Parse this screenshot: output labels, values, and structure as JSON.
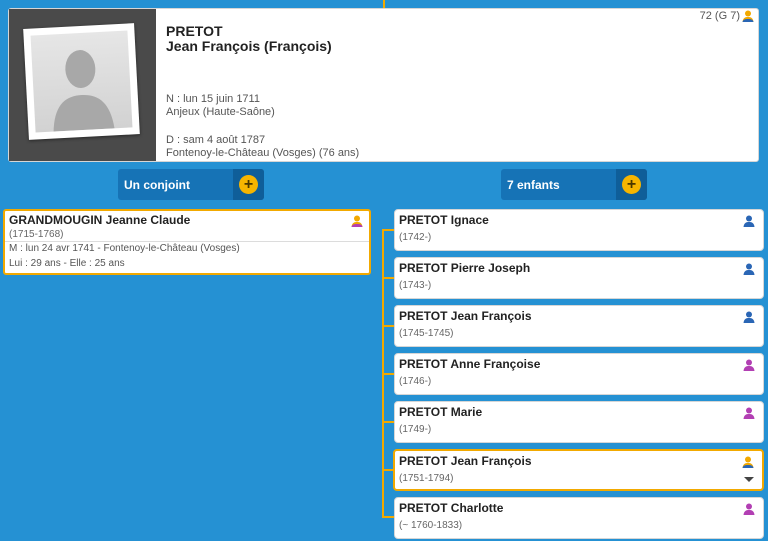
{
  "person": {
    "surname": "PRETOT",
    "given_names": "Jean François (François)",
    "sosa": "72 (G 7)",
    "birth": "N : lun 15 juin 1711",
    "birth_place": "Anjeux (Haute-Saône)",
    "death": "D : sam 4 août 1787",
    "death_place": "Fontenoy-le-Château (Vosges) (76 ans)",
    "photo_icon": "person-silhouette-icon"
  },
  "spouse_section": {
    "label": "Un conjoint",
    "add_icon": "+"
  },
  "children_section": {
    "label": "7 enfants",
    "add_icon": "+"
  },
  "spouse": {
    "name": "GRANDMOUGIN Jeanne Claude",
    "dates": "(1715-1768)",
    "marriage": "M : lun 24 avr 1741 - Fontenoy-le-Château (Vosges)",
    "ages": "Lui : 29 ans - Elle : 25 ans",
    "gender": "female",
    "highlight": "yellow"
  },
  "children": [
    {
      "name": "PRETOT Ignace",
      "dates": "(1742-)",
      "gender": "male"
    },
    {
      "name": "PRETOT Pierre Joseph",
      "dates": "(1743-)",
      "gender": "male"
    },
    {
      "name": "PRETOT Jean François",
      "dates": "(1745-1745)",
      "gender": "male"
    },
    {
      "name": "PRETOT Anne Françoise",
      "dates": "(1746-)",
      "gender": "female"
    },
    {
      "name": "PRETOT Marie",
      "dates": "(1749-)",
      "gender": "female"
    },
    {
      "name": "PRETOT Jean François",
      "dates": "(1751-1794)",
      "gender": "ancestor",
      "selected": true
    },
    {
      "name": "PRETOT Charlotte",
      "dates": "(~ 1760-1833)",
      "gender": "female"
    }
  ],
  "colors": {
    "background": "#2591d3",
    "male": "#2a66b5",
    "female": "#b23fb3",
    "ancestor": "#f2a900",
    "button": "#1673b6"
  }
}
